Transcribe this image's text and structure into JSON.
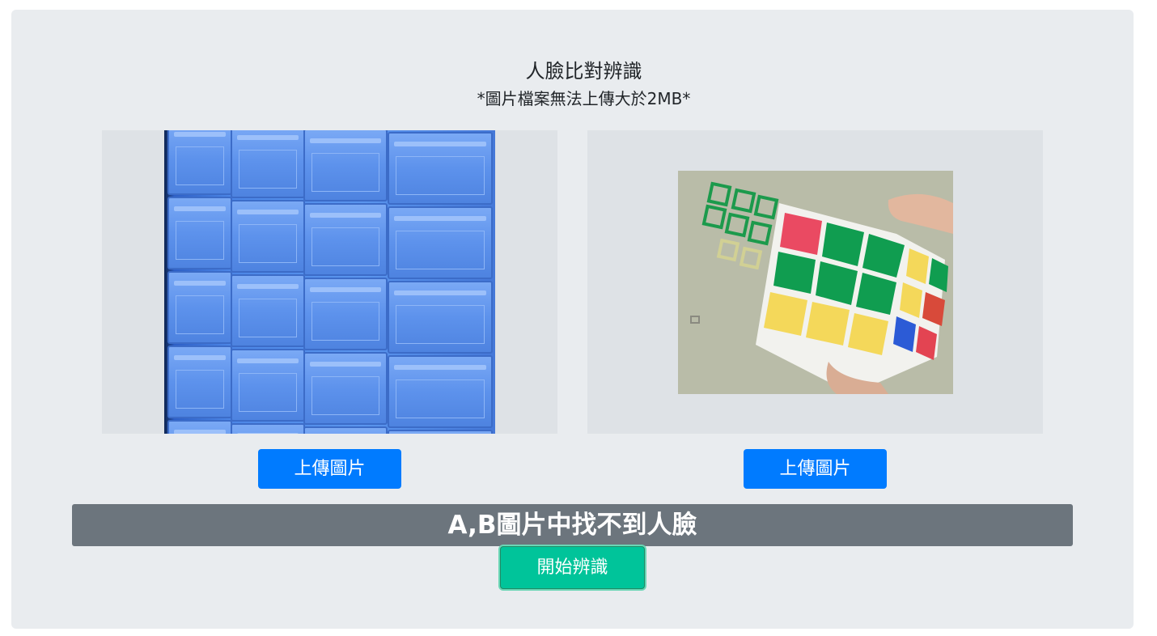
{
  "header": {
    "title": "人臉比對辨識",
    "subtitle": "*圖片檔案無法上傳大於2MB*"
  },
  "image_a": {
    "alt": "crates"
  },
  "image_b": {
    "alt": "rubik-cube"
  },
  "buttons": {
    "upload_a": "上傳圖片",
    "upload_b": "上傳圖片",
    "start": "開始辨識"
  },
  "result": {
    "message": "A,B圖片中找不到人臉"
  },
  "colors": {
    "panel_bg": "#e9ecef",
    "upload_button": "#007bff",
    "start_button": "#00c49a",
    "result_bar": "#6c757d"
  }
}
